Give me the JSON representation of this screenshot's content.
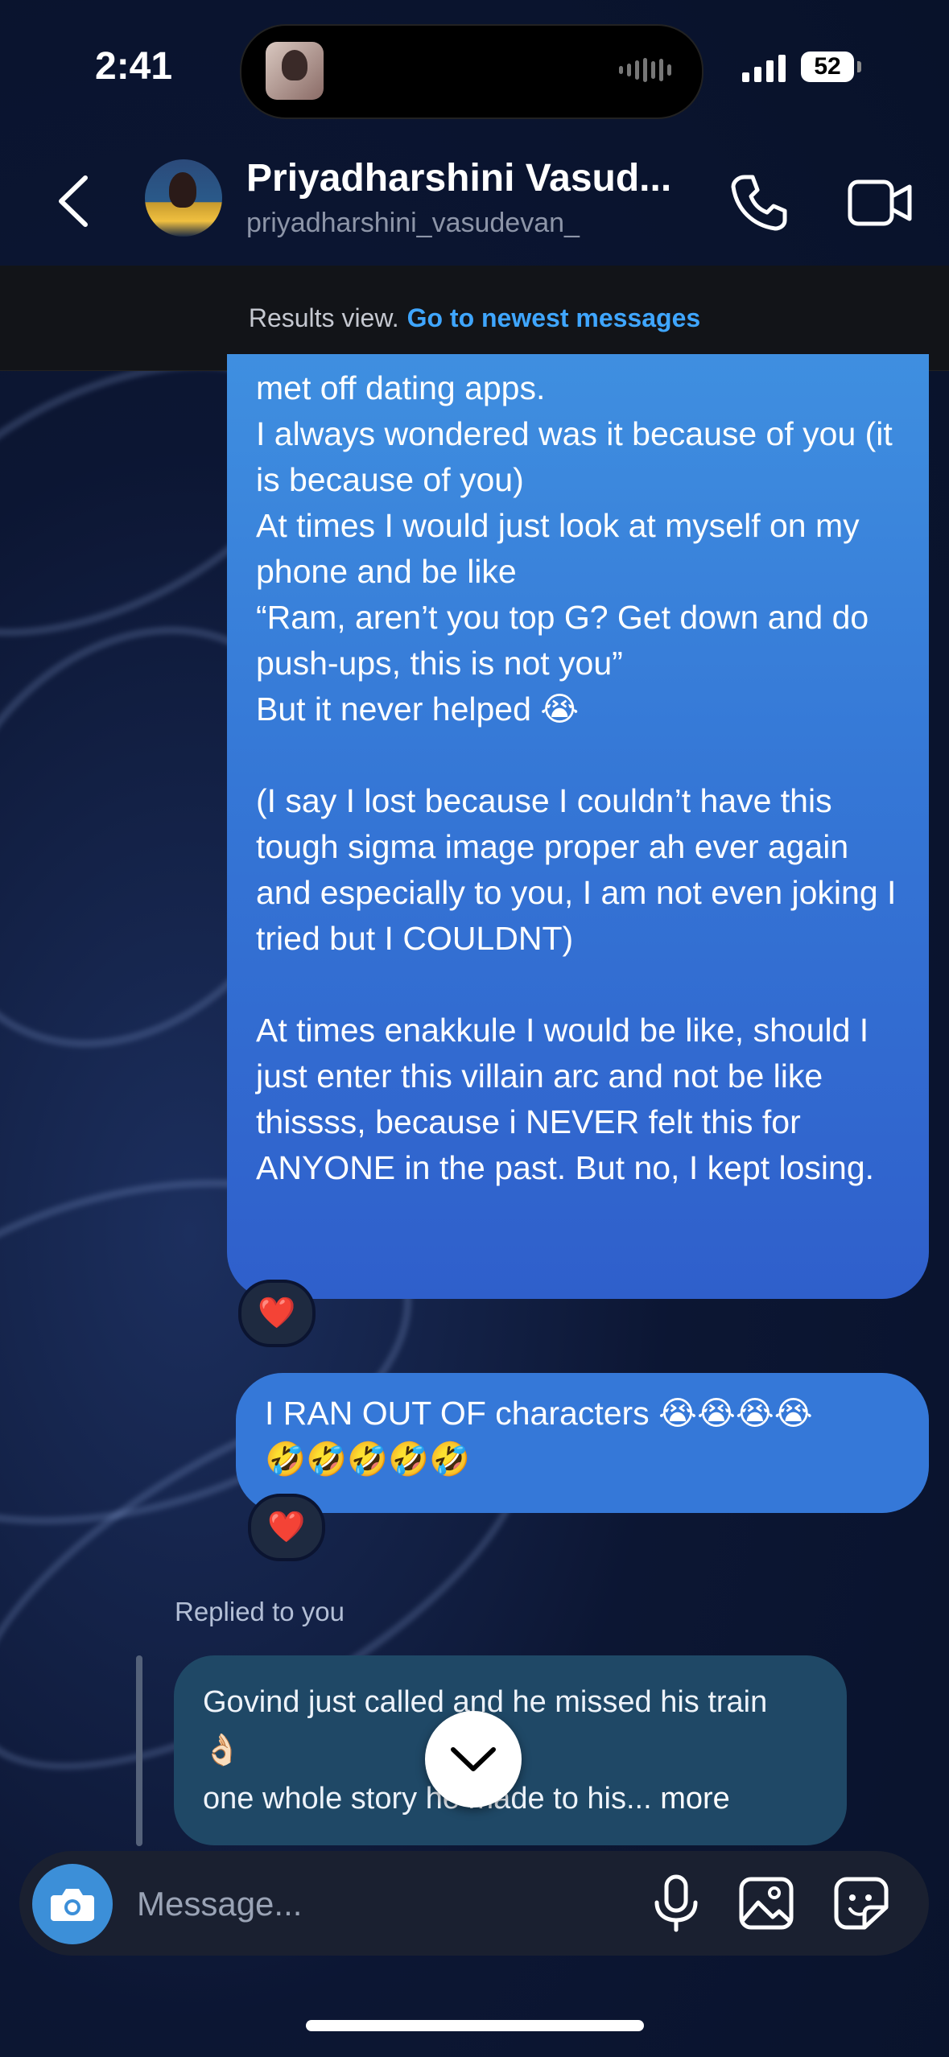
{
  "status_bar": {
    "time": "2:41",
    "battery": "52"
  },
  "header": {
    "name": "Priyadharshini Vasud...",
    "handle": "priyadharshini_vasudevan_"
  },
  "results_banner": {
    "text": "Results view.",
    "link": "Go to newest messages"
  },
  "messages": [
    {
      "text": "met off dating apps.\nI always wondered was it because of you (it is because of you)\nAt times I would just look at myself on my phone and be like\n“Ram, aren’t you top G? Get down and do push-ups, this is not you”\nBut it never helped 😭\n\n(I say I lost because I couldn’t have this tough sigma image proper ah ever again and especially to you, I am not even joking I tried but I COULDNT)\n\nAt times enakkule I would be like, should I just enter this villain arc and not be like thissss, because i NEVER felt this for ANYONE in the past. But no, I kept losing.",
      "reaction": "❤️"
    },
    {
      "text": "I RAN OUT OF characters 😭😭😭😭\n🤣🤣🤣🤣🤣",
      "reaction": "❤️"
    }
  ],
  "reply": {
    "label": "Replied to you",
    "text": "Govind just called and he missed his train\n👌🏻\none whole story he made to his...",
    "more": " more"
  },
  "composer": {
    "placeholder": "Message..."
  },
  "icons": {
    "back": "chevron-left-icon",
    "call": "phone-icon",
    "video": "video-camera-icon",
    "camera": "camera-icon",
    "mic": "microphone-icon",
    "gallery": "image-icon",
    "sticker": "sticker-icon",
    "scroll_down": "chevron-down-icon"
  },
  "colors": {
    "accent": "#3fa6ff",
    "bubble": "#3578d8",
    "reply_bubble": "#1f4866"
  }
}
